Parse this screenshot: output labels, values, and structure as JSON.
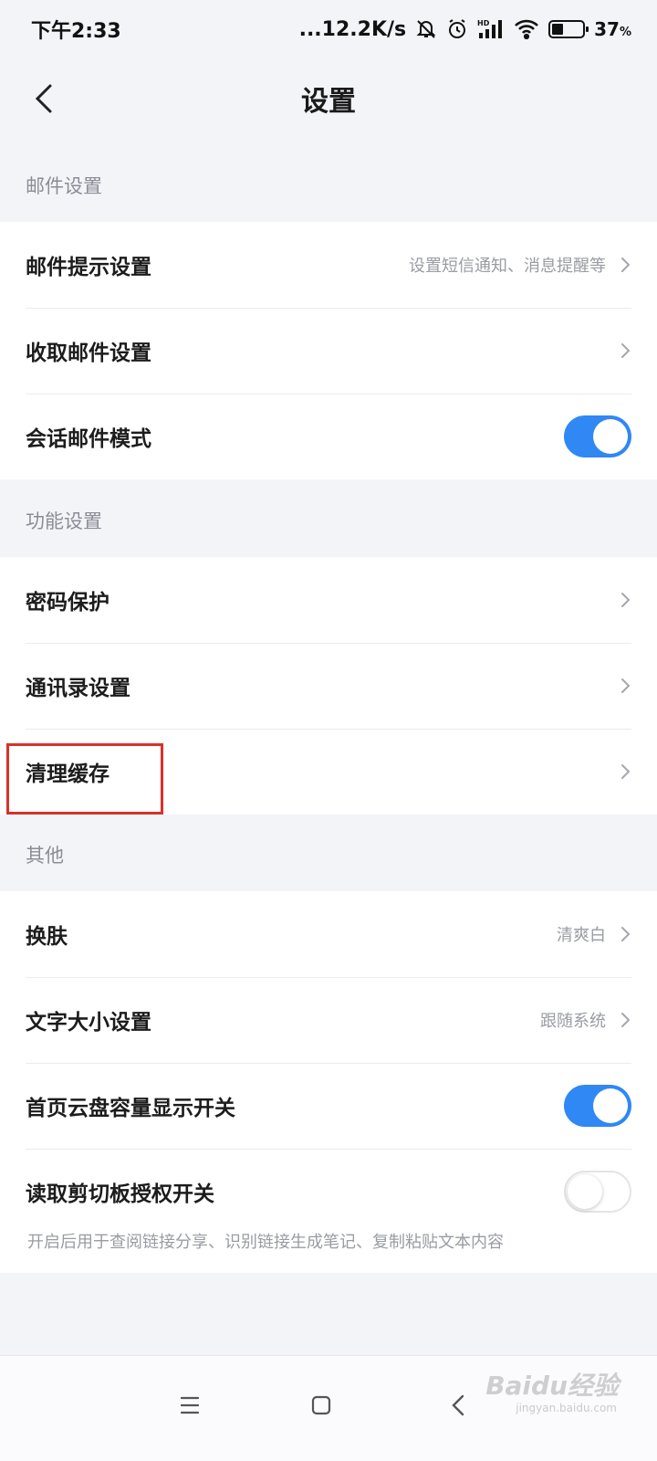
{
  "status_bar": {
    "time": "下午2:33",
    "network_speed": "...12.2K/s",
    "hd_label": "HD",
    "battery_percent": "37",
    "percent_sign": "%"
  },
  "header": {
    "title": "设置"
  },
  "sections": [
    {
      "label": "邮件设置",
      "items": [
        {
          "label": "邮件提示设置",
          "value": "设置短信通知、消息提醒等",
          "control": "chevron"
        },
        {
          "label": "收取邮件设置",
          "value": "",
          "control": "chevron"
        },
        {
          "label": "会话邮件模式",
          "value": "",
          "control": "toggle",
          "on": true
        }
      ]
    },
    {
      "label": "功能设置",
      "items": [
        {
          "label": "密码保护",
          "value": "",
          "control": "chevron"
        },
        {
          "label": "通讯录设置",
          "value": "",
          "control": "chevron"
        },
        {
          "label": "清理缓存",
          "value": "",
          "control": "chevron"
        }
      ]
    },
    {
      "label": "其他",
      "items": [
        {
          "label": "换肤",
          "value": "清爽白",
          "control": "chevron"
        },
        {
          "label": "文字大小设置",
          "value": "跟随系统",
          "control": "chevron"
        },
        {
          "label": "首页云盘容量显示开关",
          "value": "",
          "control": "toggle",
          "on": true
        },
        {
          "label": "读取剪切板授权开关",
          "value": "",
          "control": "toggle",
          "on": false
        }
      ],
      "hint": "开启后用于查阅链接分享、识别链接生成笔记、复制粘贴文本内容"
    }
  ],
  "nav_bar": {
    "menu_icon": "menu-icon",
    "home_icon": "home-square-icon",
    "back_icon": "back-triangle-icon"
  },
  "watermark": {
    "brand": "Baidu经验",
    "url": "jingyan.baidu.com"
  },
  "colors": {
    "accent": "#2f88f4",
    "highlight": "#d8312b",
    "background": "#f3f4f8"
  }
}
